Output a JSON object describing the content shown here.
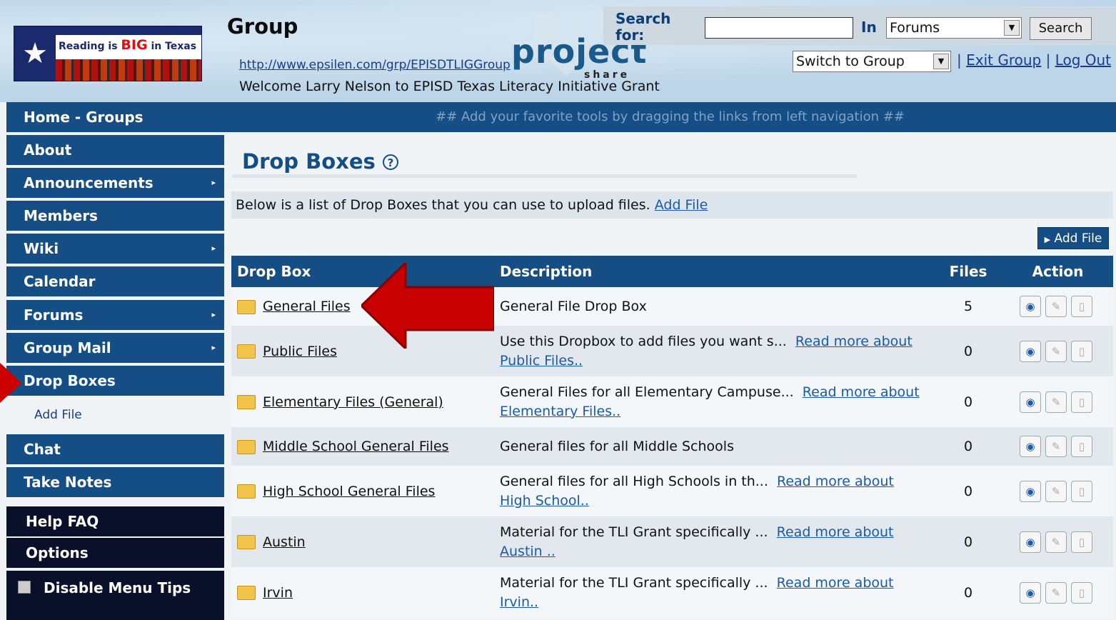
{
  "header": {
    "logo_text": "Reading is BIG in Texas",
    "group_title": "Group",
    "group_url": "http://www.epsilen.com/grp/EPISDTLIGGroup",
    "welcome": "Welcome Larry Nelson to EPISD Texas Literacy Initiative Grant",
    "project_word": "project",
    "project_share": "share",
    "search_label": "Search for:",
    "search_value": "",
    "in_label": "In",
    "scope_value": "Forums",
    "search_button": "Search",
    "switch_value": "Switch to Group",
    "exit_group": "Exit Group",
    "log_out": "Log Out"
  },
  "sidebar": {
    "items": [
      {
        "label": "Home - Groups"
      },
      {
        "label": "About"
      },
      {
        "label": "Announcements"
      },
      {
        "label": "Members"
      },
      {
        "label": "Wiki"
      },
      {
        "label": "Calendar"
      },
      {
        "label": "Forums"
      },
      {
        "label": "Group Mail"
      },
      {
        "label": "Drop Boxes"
      },
      {
        "label": "Add File"
      },
      {
        "label": "Chat"
      },
      {
        "label": "Take Notes"
      }
    ],
    "help": "Help FAQ",
    "options": "Options",
    "disable_tips": "Disable Menu Tips"
  },
  "tools_bar": "## Add your favorite tools by dragging the links from left navigation ##",
  "page_heading": "Drop Boxes",
  "info_text": "Below is a list of Drop Boxes that you can use to upload files.",
  "info_link": "Add File",
  "add_file_button": "Add File",
  "table": {
    "headers": [
      "Drop Box",
      "Description",
      "Files",
      "Action"
    ],
    "rows": [
      {
        "name": "General Files",
        "description": "General File Drop Box",
        "more": "",
        "files": "5"
      },
      {
        "name": "Public Files",
        "description": "Use this Dropbox to add files you want s...",
        "more": "Read more about Public Files..",
        "files": "0"
      },
      {
        "name": "Elementary Files (General)",
        "description": "General Files for all Elementary Campuse...",
        "more": "Read more about Elementary Files..",
        "files": "0"
      },
      {
        "name": "Middle School General Files",
        "description": "General files for all Middle Schools",
        "more": "",
        "files": "0"
      },
      {
        "name": "High School General Files",
        "description": "General files for all High Schools in th...",
        "more": "Read more about High School..",
        "files": "0"
      },
      {
        "name": "Austin",
        "description": "Material for the TLI Grant specifically ...",
        "more": "Read more about Austin ..",
        "files": "0"
      },
      {
        "name": "Irvin",
        "description": "Material for the TLI Grant specifically ...",
        "more": "Read more about Irvin..",
        "files": "0"
      }
    ]
  },
  "colors": {
    "nav_blue": "#154e85",
    "header_bg": "#bcd5e8",
    "arrow_red": "#c80000",
    "dark_nav": "#0a0f2a"
  },
  "icons": {
    "view": "eye-icon",
    "edit": "pencil-icon",
    "delete": "trash-icon",
    "folder": "folder-icon"
  }
}
